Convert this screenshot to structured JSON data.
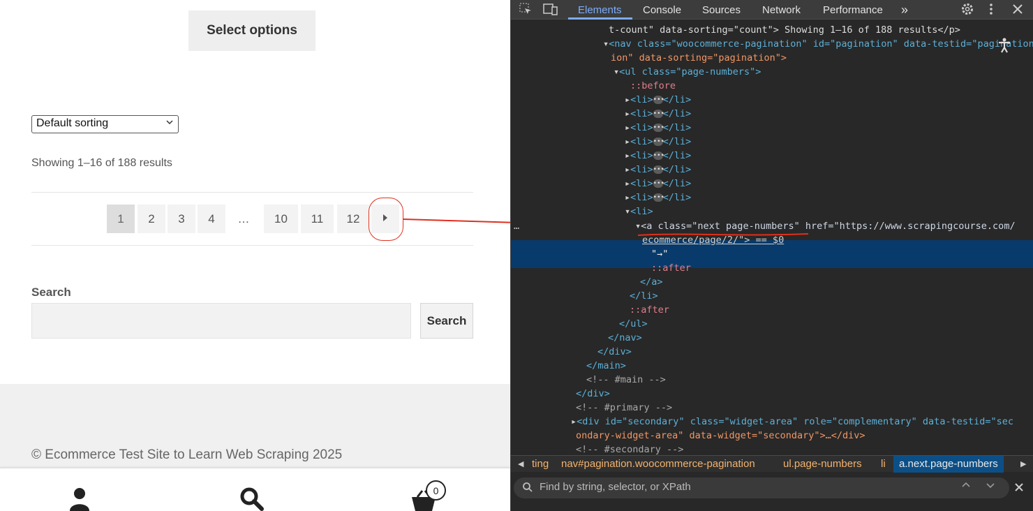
{
  "shop": {
    "select_options": "Select options",
    "sort_value": "Default sorting",
    "result_count": "Showing 1–16 of 188 results",
    "pagination": [
      "1",
      "2",
      "3",
      "4",
      "…",
      "10",
      "11",
      "12"
    ],
    "next_glyph": "►",
    "search_label": "Search",
    "search_button": "Search",
    "copyright": "© Ecommerce Test Site to Learn Web Scraping 2025",
    "cart_count": "0"
  },
  "devtools": {
    "tabs": [
      "Elements",
      "Console",
      "Sources",
      "Network",
      "Performance"
    ],
    "more_tabs": "»",
    "code_lines": [
      "t-count\" data-sorting=\"count\"> Showing 1–16 of 188 results</p>",
      "<nav class=\"woocommerce-pagination\" id=\"pagination\" data-testid=\"pagination\"",
      "ion\" data-sorting=\"pagination\">",
      "<ul class=\"page-numbers\">",
      "::before",
      "<li>…</li>",
      "<a class=\"next page-numbers\" href=\"https://www.scrapingcourse.com/",
      "ecommerce/page/2/\"> == $0",
      "\"→\"",
      "::after",
      "</a>",
      "</li>",
      "</ul>",
      "</nav>",
      "</div>",
      "</main>",
      "<!-- #main -->",
      "<!-- #primary -->",
      "<div id=\"secondary\" class=\"widget-area\" role=\"complementary\" data-testid=\"sec",
      "ondary-widget-area\" data-widget=\"secondary\">…</div>",
      "<!-- #secondary -->"
    ],
    "breadcrumbs": [
      "ting",
      "nav#pagination.woocommerce-pagination",
      "ul.page-numbers",
      "li",
      "a.next.page-numbers"
    ],
    "find_placeholder": "Find by string, selector, or XPath"
  },
  "colors": {
    "annotation": "#e0301e",
    "selection": "#083b6b",
    "tab_active": "#7cacf8"
  }
}
